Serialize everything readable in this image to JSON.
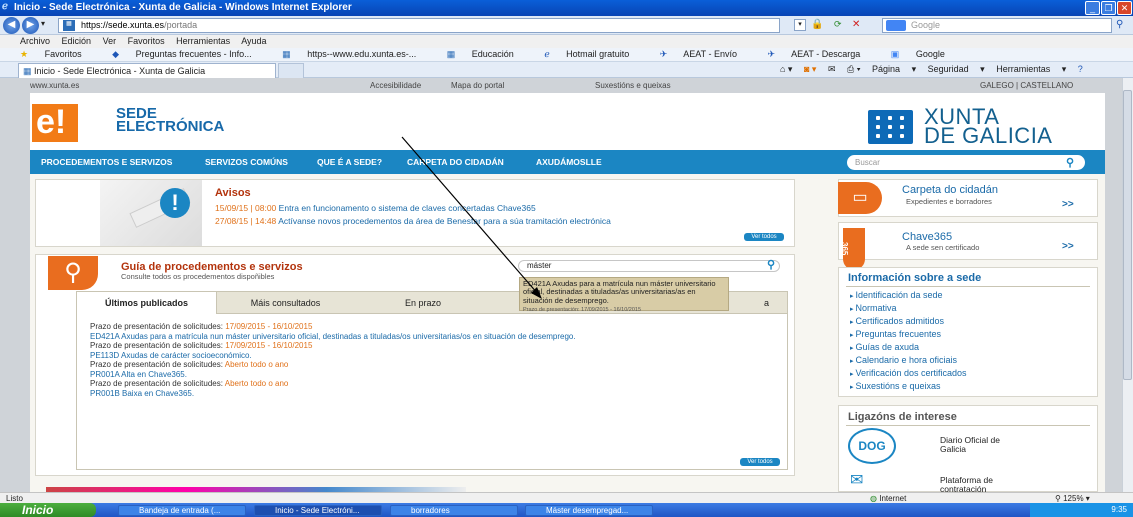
{
  "window": {
    "title": "Inicio - Sede Electrónica - Xunta de Galicia - Windows Internet Explorer"
  },
  "address": {
    "url_domain": "https://sede.xunta.es",
    "url_path": "/portada",
    "search_placeholder": "Google"
  },
  "menu": [
    "Archivo",
    "Edición",
    "Ver",
    "Favoritos",
    "Herramientas",
    "Ayuda"
  ],
  "favorites": {
    "label": "Favoritos",
    "items": [
      "Preguntas frecuentes - Info...",
      "https--www.edu.xunta.es-...",
      "Educación",
      "Hotmail gratuito",
      "AEAT - Envío",
      "AEAT - Descarga",
      "Google"
    ]
  },
  "tab": {
    "title": "Inicio - Sede Electrónica - Xunta de Galicia"
  },
  "commands": [
    "Página",
    "Seguridad",
    "Herramientas"
  ],
  "site": {
    "top_url": "www.xunta.es",
    "top_links": [
      "Accesibilidade",
      "Mapa do portal",
      "Suxestións e queixas"
    ],
    "lang": "GALEGO | CASTELLANO",
    "logo_letter": "e!",
    "sede_line1": "SEDE",
    "sede_line2": "ELECTRÓNICA",
    "xunta_line1": "XUNTA",
    "xunta_line2": "DE GALICIA",
    "nav": [
      "PROCEDEMENTOS E SERVIZOS",
      "SERVIZOS COMÚNS",
      "QUE É A SEDE?",
      "CARPETA DO CIDADÁN",
      "AXUDÁMOSLLE"
    ],
    "search_placeholder": "Buscar"
  },
  "avisos": {
    "title": "Avisos",
    "news": [
      {
        "date": "15/09/15 | 08:00",
        "text": "Entra en funcionamento o sistema de claves concertadas Chave365"
      },
      {
        "date": "27/08/15 | 14:48",
        "text": "Actívanse novos procedementos da área de Benestar para a súa tramitación electrónica"
      }
    ],
    "more": "Ver todos"
  },
  "guia": {
    "title": "Guía de procedementos e servizos",
    "subtitle": "Consulte todos os procedementos dispoñibles",
    "search_value": "máster",
    "tabs": [
      "Últimos publicados",
      "Máis consultados",
      "En prazo",
      "",
      "a"
    ],
    "items": [
      {
        "label": "Prazo de presentación de solicitudes:",
        "date": "17/09/2015 - 16/10/2015",
        "title": "ED421A Axudas para a matrícula nun máster universitario oficial, destinadas a tituladas/os universitarias/os en situación de desemprego."
      },
      {
        "label": "Prazo de presentación de solicitudes:",
        "date": "17/09/2015 - 16/10/2015",
        "title": "PE113D Axudas de carácter socioeconómico."
      },
      {
        "label": "Prazo de presentación de solicitudes:",
        "date": "Aberto todo o ano",
        "title": "PR001A Alta en Chave365."
      },
      {
        "label": "Prazo de presentación de solicitudes:",
        "date": "Aberto todo o ano",
        "title": "PR001B Baixa en Chave365."
      }
    ],
    "more": "Ver todos",
    "tooltip_title": "ED421A Axudas para a matrícula nun máster universitario oficial, destinadas a tituladas/as universitarias/as en situación de desemprego.",
    "tooltip_sub": "Prazo de presentación: 17/09/2015 - 16/10/2015"
  },
  "right": {
    "carpeta_title": "Carpeta do cidadán",
    "carpeta_sub": "Expedientes e borradores",
    "chave_title": "Chave365",
    "chave_sub": "A sede sen certificado",
    "chave_icon": "365",
    "info_title": "Información sobre a sede",
    "info_links": [
      "Identificación da sede",
      "Normativa",
      "Certificados admitidos",
      "Preguntas frecuentes",
      "Guías de axuda",
      "Calendario e hora oficiais",
      "Verificación dos certificados",
      "Suxestións e queixas"
    ],
    "lig_title": "Ligazóns de interese",
    "doga_icon": "DOG",
    "lig_items": [
      "Diario Oficial de Galicia",
      "Plataforma de contratación"
    ],
    "arrow": ">>"
  },
  "status": {
    "left": "Listo",
    "zone": "Internet",
    "zoom": "125%"
  },
  "taskbar": {
    "start": "Inicio",
    "items": [
      "Bandeja de entrada (...",
      "Inicio - Sede Electróni...",
      "borradores",
      "Máster desempregad..."
    ],
    "time": "9:35"
  }
}
